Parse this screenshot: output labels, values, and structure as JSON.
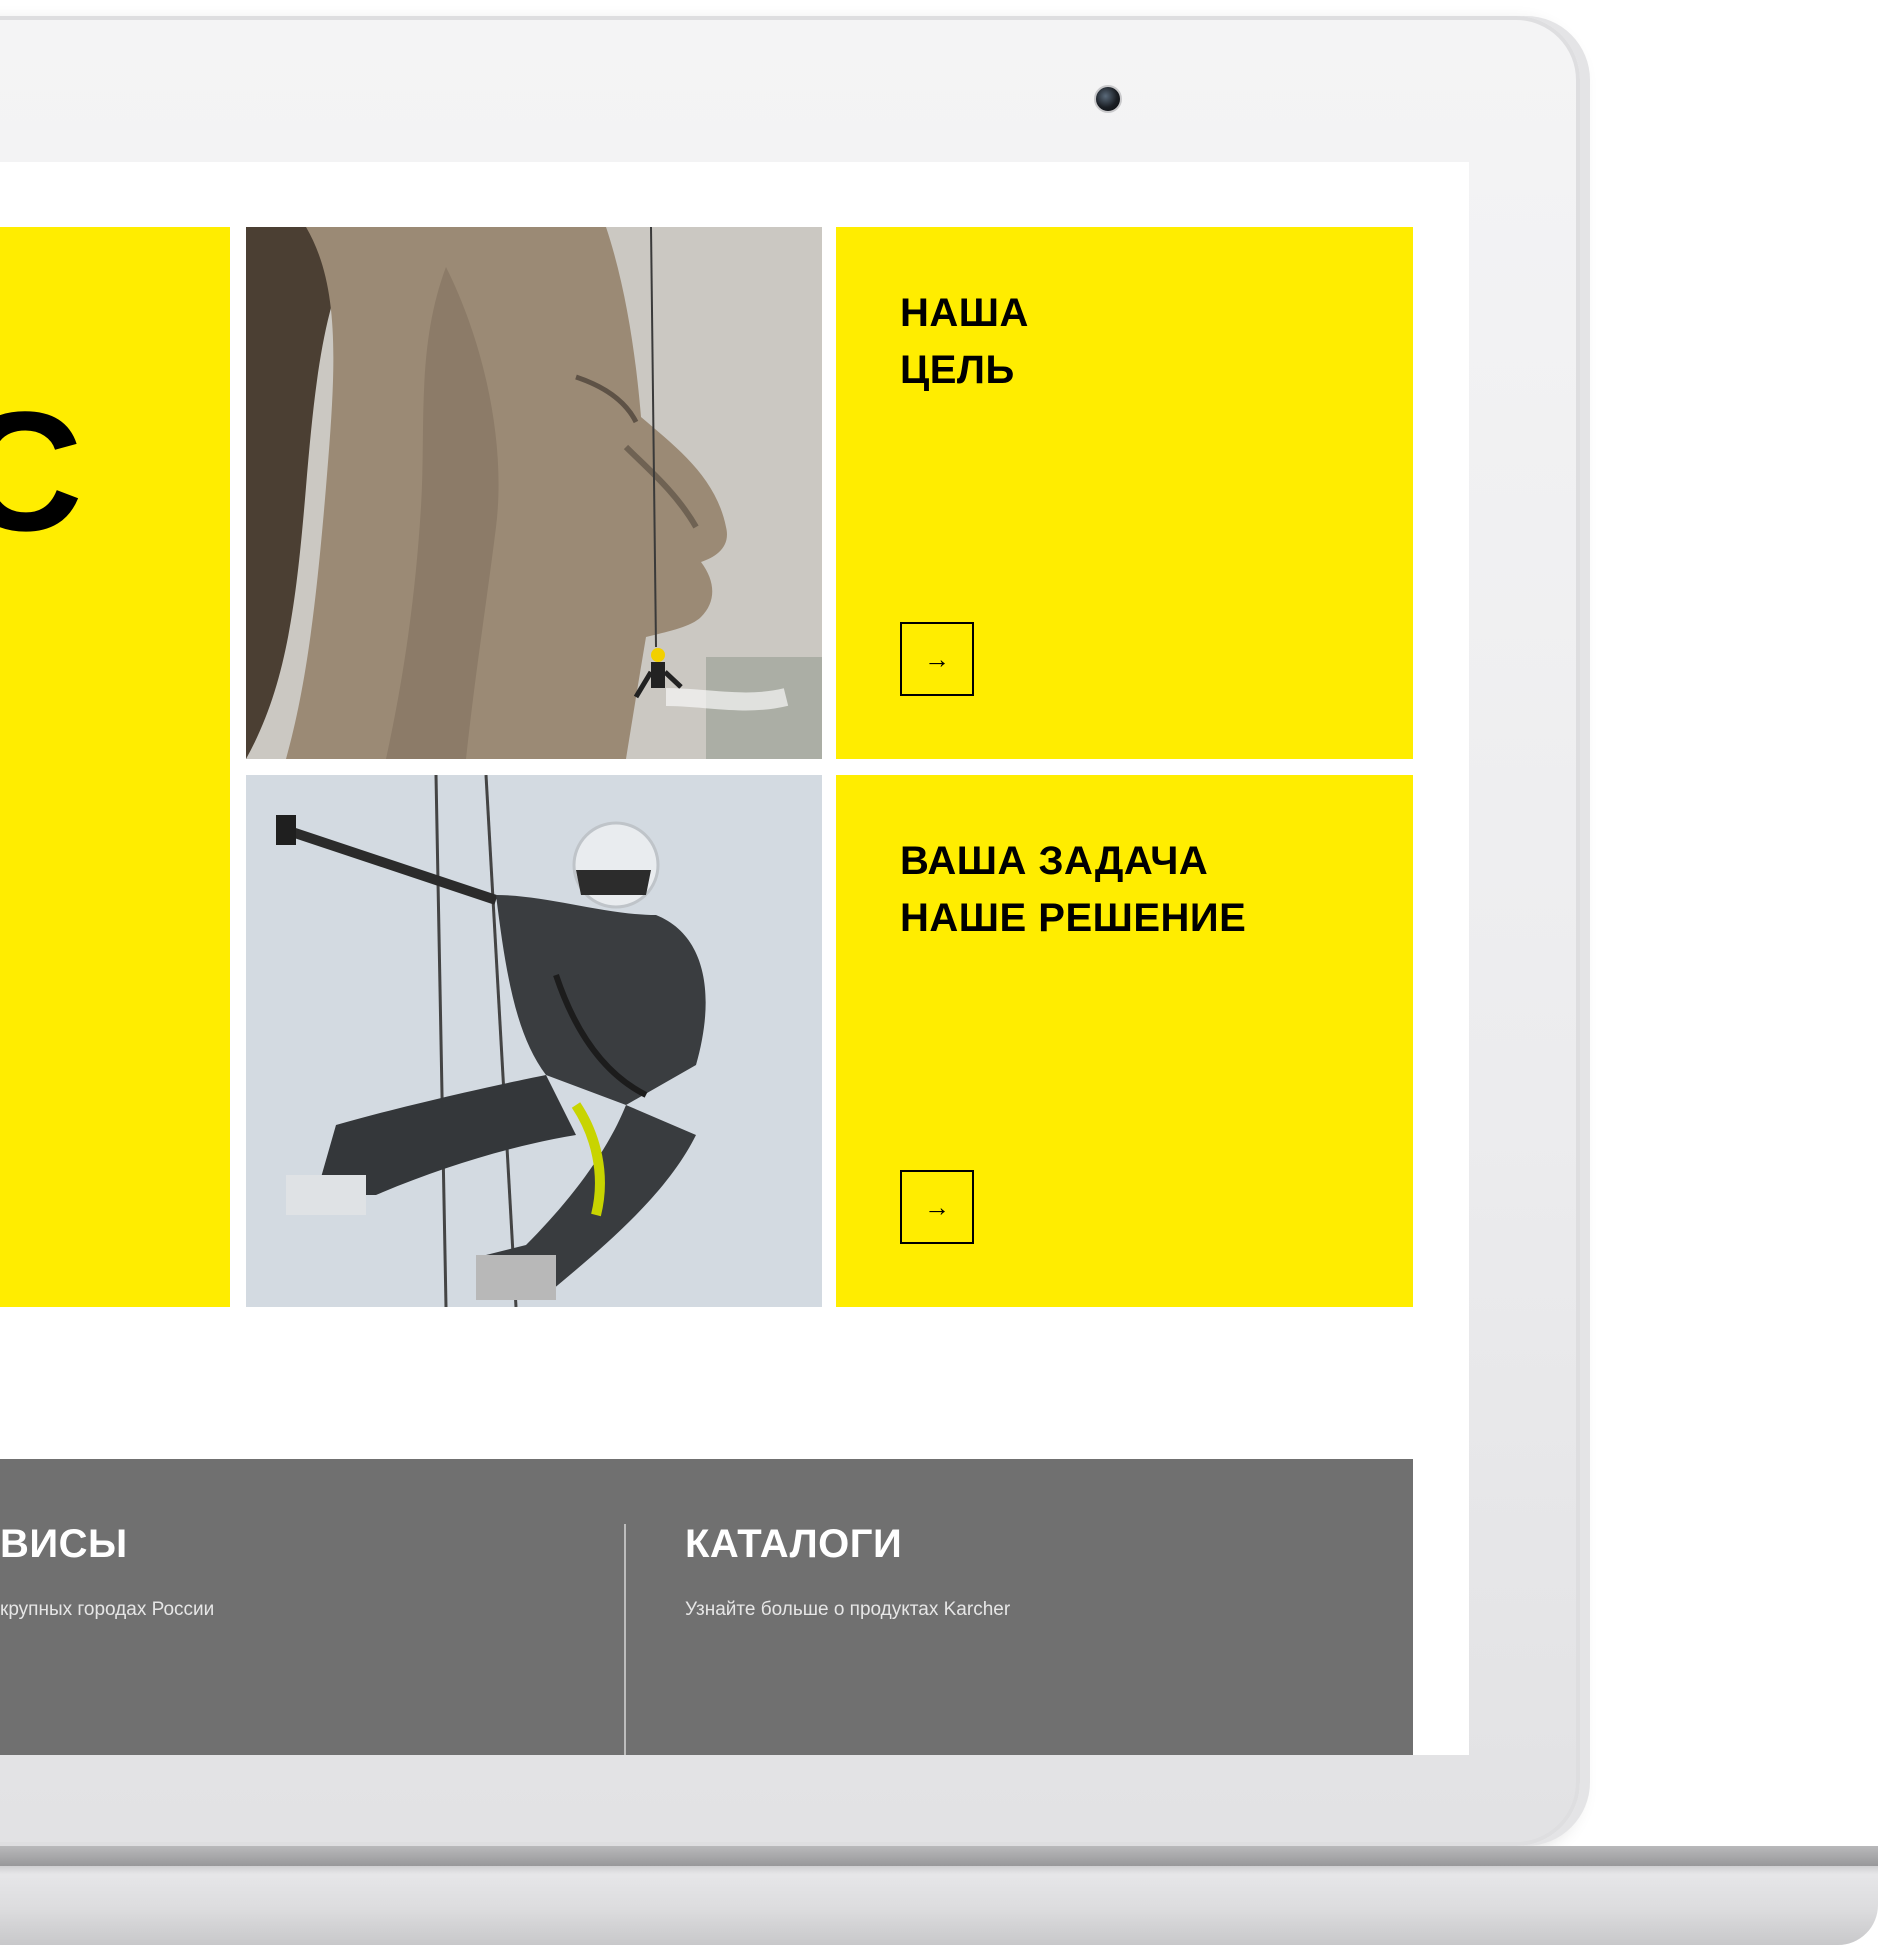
{
  "tiles": {
    "left_partial_glyph": "С",
    "goal": {
      "title": "НАША\nЦЕЛЬ",
      "button_icon": "→"
    },
    "task": {
      "title": "ВАША ЗАДАЧА\nНАШЕ РЕШЕНИЕ",
      "button_icon": "→"
    }
  },
  "footer": {
    "services": {
      "title": "ВИСЫ",
      "description": "крупных городах России"
    },
    "catalogs": {
      "title": "КАТАЛОГИ",
      "description": "Узнайте больше о продуктах Karcher"
    }
  },
  "colors": {
    "brand_yellow": "#ffed00",
    "footer_gray": "#707070",
    "text_black": "#000000",
    "text_white": "#ffffff"
  },
  "icons": [
    "camera-icon",
    "arrow-right-icon"
  ]
}
